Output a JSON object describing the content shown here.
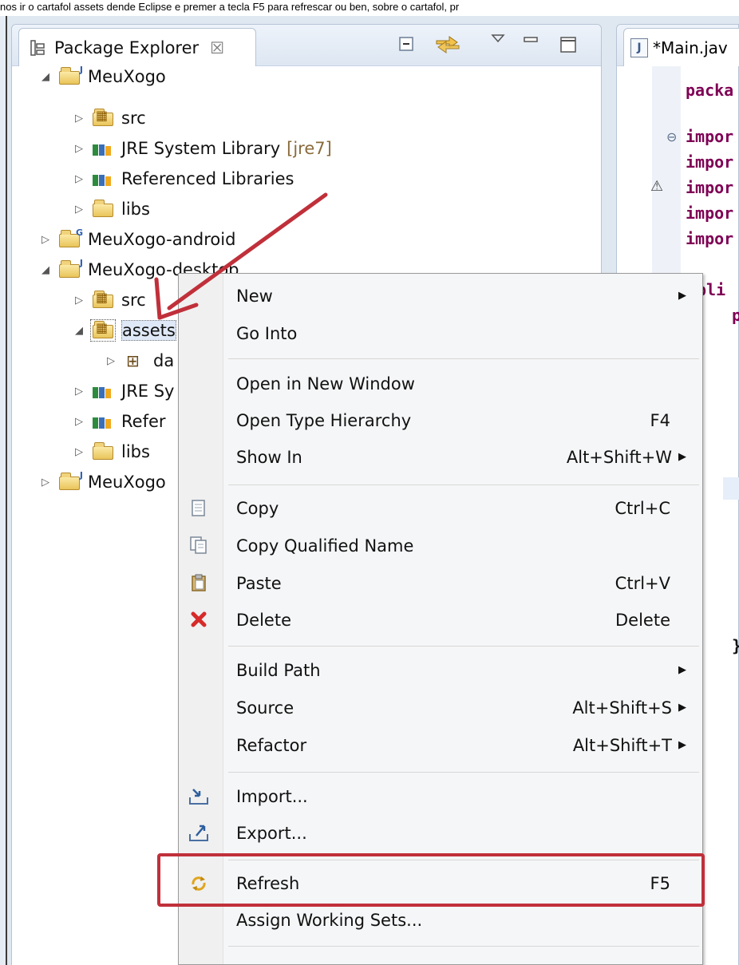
{
  "caption": "nos ir o cartafol assets dende Eclipse e premer a tecla F5 para refrescar ou ben, sobre o cartafol, pr",
  "package_explorer": {
    "tab_title": "Package Explorer",
    "tab_close": "☒",
    "toolbar_icons": [
      "collapse-all-icon",
      "link-with-editor-icon",
      "view-menu-icon",
      "minimize-icon",
      "maximize-icon"
    ]
  },
  "tree": [
    {
      "label": "MeuXogo",
      "suffix": "",
      "icon": "java-project-icon",
      "expanded": true
    },
    {
      "label": "src",
      "suffix": "",
      "icon": "source-folder-icon",
      "expanded": false
    },
    {
      "label": "JRE System Library",
      "suffix": "[jre7]",
      "icon": "library-icon",
      "expanded": false
    },
    {
      "label": "Referenced Libraries",
      "suffix": "",
      "icon": "library-icon",
      "expanded": false
    },
    {
      "label": "libs",
      "suffix": "",
      "icon": "folder-icon",
      "expanded": false
    },
    {
      "label": "MeuXogo-android",
      "suffix": "",
      "icon": "android-project-icon",
      "expanded": false
    },
    {
      "label": "MeuXogo-desktop",
      "suffix": "",
      "icon": "java-project-icon",
      "expanded": true
    },
    {
      "label": "src",
      "suffix": "",
      "icon": "source-folder-icon",
      "expanded": false
    },
    {
      "label": "assets",
      "suffix": "",
      "icon": "source-folder-icon",
      "expanded": true
    },
    {
      "label": "da",
      "suffix": "",
      "icon": "package-icon",
      "expanded": false
    },
    {
      "label": "JRE Sy",
      "suffix": "",
      "icon": "library-icon",
      "expanded": false
    },
    {
      "label": "Refer",
      "suffix": "",
      "icon": "library-icon",
      "expanded": false
    },
    {
      "label": "libs",
      "suffix": "",
      "icon": "folder-icon",
      "expanded": false
    },
    {
      "label": "MeuXogo",
      "suffix": "",
      "icon": "java-project-icon",
      "expanded": false
    }
  ],
  "editor": {
    "tab_title": "*Main.jav",
    "lines": [
      "packa",
      "impor",
      "impor",
      "impor",
      "impor",
      "impor",
      "bli",
      "p",
      "}"
    ]
  },
  "context_menu": {
    "items": [
      {
        "label": "New",
        "shortcut": "",
        "submenu": true,
        "icon": ""
      },
      {
        "label": "Go Into",
        "shortcut": "",
        "submenu": false,
        "icon": ""
      },
      {
        "label": "Open in New Window",
        "shortcut": "",
        "submenu": false,
        "icon": ""
      },
      {
        "label": "Open Type Hierarchy",
        "shortcut": "F4",
        "submenu": false,
        "icon": ""
      },
      {
        "label": "Show In",
        "shortcut": "Alt+Shift+W",
        "submenu": true,
        "icon": ""
      },
      {
        "label": "Copy",
        "shortcut": "Ctrl+C",
        "submenu": false,
        "icon": "copy-icon"
      },
      {
        "label": "Copy Qualified Name",
        "shortcut": "",
        "submenu": false,
        "icon": "copy-qualified-name-icon"
      },
      {
        "label": "Paste",
        "shortcut": "Ctrl+V",
        "submenu": false,
        "icon": "paste-icon"
      },
      {
        "label": "Delete",
        "shortcut": "Delete",
        "submenu": false,
        "icon": "delete-icon"
      },
      {
        "label": "Build Path",
        "shortcut": "",
        "submenu": true,
        "icon": ""
      },
      {
        "label": "Source",
        "shortcut": "Alt+Shift+S",
        "submenu": true,
        "icon": ""
      },
      {
        "label": "Refactor",
        "shortcut": "Alt+Shift+T",
        "submenu": true,
        "icon": ""
      },
      {
        "label": "Import...",
        "shortcut": "",
        "submenu": false,
        "icon": "import-icon"
      },
      {
        "label": "Export...",
        "shortcut": "",
        "submenu": false,
        "icon": "export-icon"
      },
      {
        "label": "Refresh",
        "shortcut": "F5",
        "submenu": false,
        "icon": "refresh-icon"
      },
      {
        "label": "Assign Working Sets...",
        "shortcut": "",
        "submenu": false,
        "icon": ""
      }
    ]
  },
  "annotation": {
    "highlight_color": "#c0303a",
    "arrow_color": "#c0303a"
  }
}
